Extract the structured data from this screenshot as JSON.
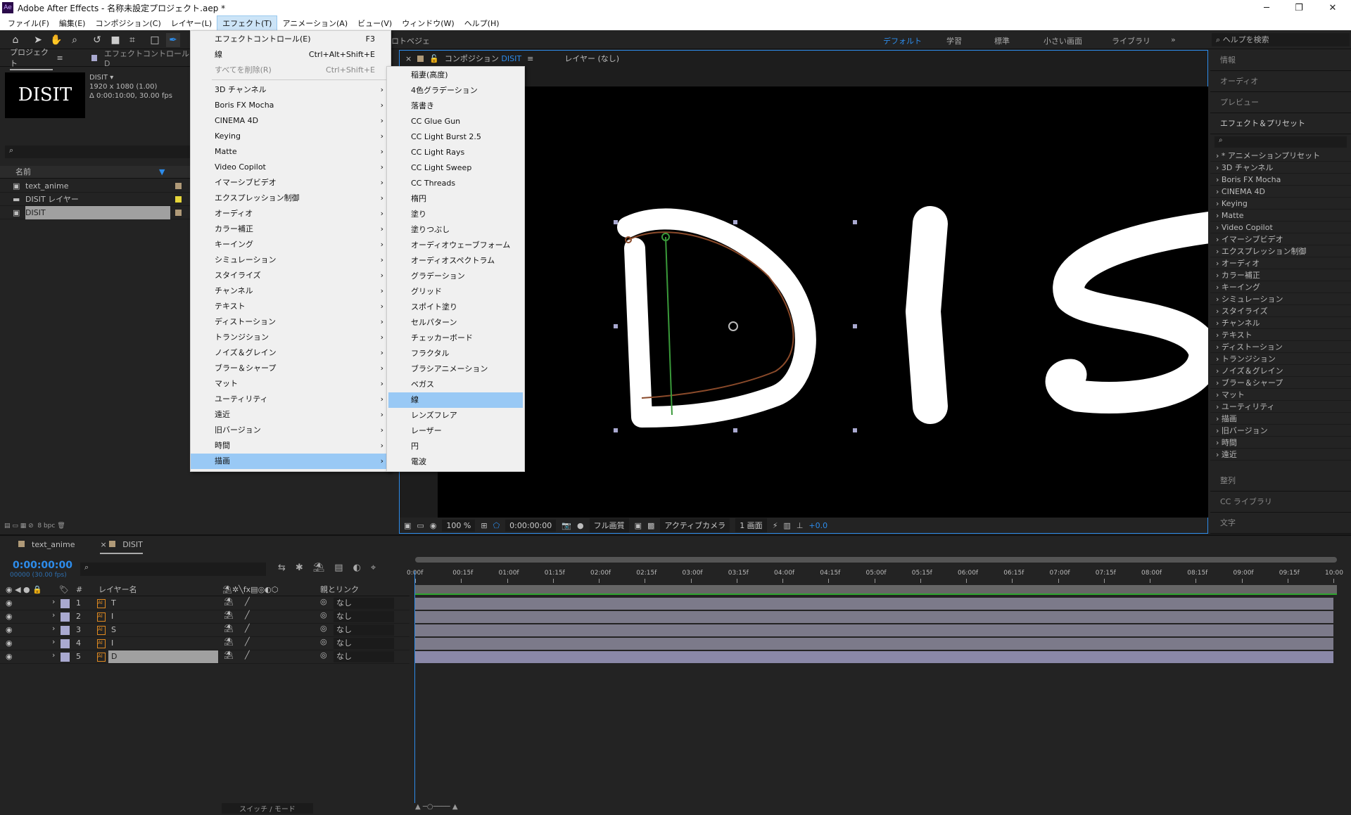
{
  "app": {
    "title": "Adobe After Effects - 名称未設定プロジェクト.aep *",
    "logo": "Ae"
  },
  "menubar": [
    "ファイル(F)",
    "編集(E)",
    "コンポジション(C)",
    "レイヤー(L)",
    "エフェクト(T)",
    "アニメーション(A)",
    "ビュー(V)",
    "ウィンドウ(W)",
    "ヘルプ(H)"
  ],
  "menubar_active": "エフェクト(T)",
  "toolbar": {
    "bezier_label": "ロトベジェ",
    "workspaces": [
      "デフォルト",
      "学習",
      "標準",
      "小さい画面",
      "ライブラリ"
    ],
    "active_workspace": "デフォルト",
    "help_placeholder": "ヘルプを検索"
  },
  "project": {
    "tab": "プロジェクト",
    "tab2": "エフェクトコントロール D",
    "comp_name": "DISIT ▾",
    "comp_size": "1920 x 1080 (1.00)",
    "comp_duration": "Δ 0:00:10:00, 30.00 fps",
    "thumb_text": "DISIT",
    "col_name": "名前",
    "items": [
      {
        "name": "text_anime",
        "color": "#b09a78"
      },
      {
        "name": "DISIT レイヤー",
        "color": "#e6d63a",
        "folder": true
      },
      {
        "name": "DISIT",
        "color": "#b09a78",
        "selected": true
      }
    ],
    "bpc": "8 bpc"
  },
  "effect_menu": {
    "top": [
      {
        "label": "エフェクトコントロール(E)",
        "shortcut": "F3"
      },
      {
        "label": "線",
        "shortcut": "Ctrl+Alt+Shift+E"
      },
      {
        "label": "すべてを削除(R)",
        "shortcut": "Ctrl+Shift+E",
        "disabled": true
      }
    ],
    "categories": [
      "3D チャンネル",
      "Boris FX Mocha",
      "CINEMA 4D",
      "Keying",
      "Matte",
      "Video Copilot",
      "イマーシブビデオ",
      "エクスプレッション制御",
      "オーディオ",
      "カラー補正",
      "キーイング",
      "シミュレーション",
      "スタイライズ",
      "チャンネル",
      "テキスト",
      "ディストーション",
      "トランジション",
      "ノイズ＆グレイン",
      "ブラー＆シャープ",
      "マット",
      "ユーティリティ",
      "遠近",
      "旧バージョン",
      "時間",
      "描画"
    ],
    "highlighted": "描画"
  },
  "submenu": {
    "items": [
      "稲妻(高度)",
      "4色グラデーション",
      "落書き",
      "CC Glue Gun",
      "CC Light Burst 2.5",
      "CC Light Rays",
      "CC Light Sweep",
      "CC Threads",
      "楕円",
      "塗り",
      "塗りつぶし",
      "オーディオウェーブフォーム",
      "オーディオスペクトラム",
      "グラデーション",
      "グリッド",
      "スポイト塗り",
      "セルパターン",
      "チェッカーボード",
      "フラクタル",
      "ブラシアニメーション",
      "ベガス",
      "線",
      "レンズフレア",
      "レーザー",
      "円",
      "電波"
    ],
    "highlighted": "線"
  },
  "viewer": {
    "tab": "コンポジション",
    "comp": "DISIT",
    "layer_tab": "レイヤー (なし)",
    "canvas_text": "DIS",
    "zoom": "100 %",
    "time": "0:00:00:00",
    "quality": "フル画質",
    "camera": "アクティブカメラ",
    "views": "1 画面",
    "exposure": "+0.0"
  },
  "right_panel": {
    "top": [
      "情報",
      "オーディオ",
      "プレビュー"
    ],
    "effects_title": "エフェクト＆プリセット",
    "effects": [
      "* アニメーションプリセット",
      "3D チャンネル",
      "Boris FX Mocha",
      "CINEMA 4D",
      "Keying",
      "Matte",
      "Video Copilot",
      "イマーシブビデオ",
      "エクスプレッション制御",
      "オーディオ",
      "カラー補正",
      "キーイング",
      "シミュレーション",
      "スタイライズ",
      "チャンネル",
      "テキスト",
      "ディストーション",
      "トランジション",
      "ノイズ＆グレイン",
      "ブラー＆シャープ",
      "マット",
      "ユーティリティ",
      "描画",
      "旧バージョン",
      "時間",
      "遠近"
    ],
    "bottom": [
      "整列",
      "CC ライブラリ",
      "文字"
    ]
  },
  "timeline": {
    "tabs": [
      "text_anime",
      "DISIT"
    ],
    "timecode": "0:00:00:00",
    "frames": "00000 (30.00 fps)",
    "col_layer": "レイヤー名",
    "col_parent": "親とリンク",
    "col_num": "#",
    "layers": [
      {
        "num": "1",
        "name": "T",
        "parent": "なし"
      },
      {
        "num": "2",
        "name": "I",
        "parent": "なし"
      },
      {
        "num": "3",
        "name": "S",
        "parent": "なし"
      },
      {
        "num": "4",
        "name": "I",
        "parent": "なし"
      },
      {
        "num": "5",
        "name": "D",
        "parent": "なし",
        "selected": true
      }
    ],
    "ticks": [
      "0:00f",
      "00:15f",
      "01:00f",
      "01:15f",
      "02:00f",
      "02:15f",
      "03:00f",
      "03:15f",
      "04:00f",
      "04:15f",
      "05:00f",
      "05:15f",
      "06:00f",
      "06:15f",
      "07:00f",
      "07:15f",
      "08:00f",
      "08:15f",
      "09:00f",
      "09:15f",
      "10:00"
    ],
    "switch_mode": "スイッチ / モード"
  },
  "colors": {
    "accent": "#2d8ceb",
    "menu_highlight": "#99c9f5",
    "layer_label": "#a9a9d0"
  }
}
